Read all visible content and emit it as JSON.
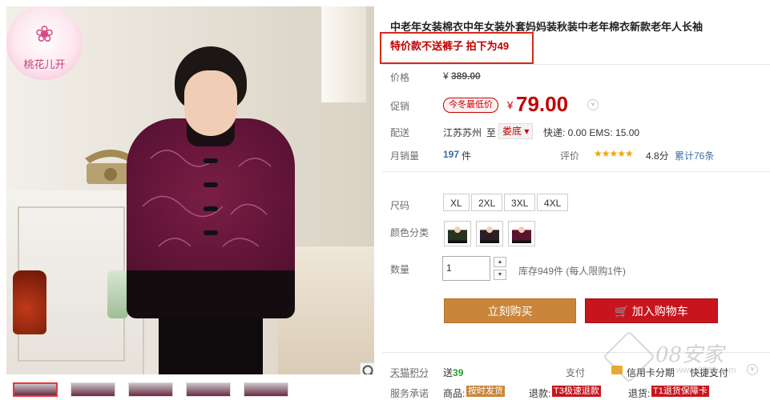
{
  "gallery": {
    "logo_mark": "❀",
    "logo_text": "桃花儿开",
    "zoom_icon": "magnifier-icon"
  },
  "product": {
    "title": "中老年女装棉衣中年女装外套妈妈装秋装中老年棉衣新款老年人长袖",
    "promo_note": "特价款不送裤子 拍下为49"
  },
  "price": {
    "orig_label": "价格",
    "orig_currency": "¥",
    "orig_value": "389.00",
    "promo_label": "促销",
    "badge": "今冬最低价",
    "currency": "¥",
    "value": "79.00",
    "dropdown_icon": "˅"
  },
  "shipping": {
    "label": "配送",
    "from": "江苏苏州",
    "to_label": "至",
    "dest": "娄底 ▾",
    "cost": "快递: 0.00 EMS: 15.00"
  },
  "sales": {
    "label": "月销量",
    "count": "197",
    "unit": "件",
    "rating_label": "评价",
    "stars": "★★★★★",
    "score": "4.8分",
    "total": "累计76条"
  },
  "options": {
    "size_label": "尺码",
    "sizes": [
      "XL",
      "2XL",
      "3XL",
      "4XL"
    ],
    "color_label": "颜色分类",
    "colors": [
      "#26331f",
      "#2a1f26",
      "#5a1430"
    ],
    "qty_label": "数量",
    "qty_value": "1",
    "stock": "库存949件  (每人限购1件)",
    "up_icon": "▲",
    "down_icon": "▼"
  },
  "actions": {
    "buy_now": "立刻购买",
    "cart_icon": "🛒",
    "add_cart": "加入购物车"
  },
  "extras": {
    "points_label": "天猫积分",
    "points_prefix": "送",
    "points_value": "39",
    "pay_label": "支付",
    "card_label": "信用卡分期",
    "fast_pay": "快捷支付",
    "pay_dd": "˅",
    "service_label": "服务承诺",
    "svc_goods": "商品:",
    "svc_goods_tag": "按时发货",
    "svc_refund": "退款:",
    "svc_refund_tag": "T3极速退款",
    "svc_return": "退货:",
    "svc_return_tag": "T1退货保障卡"
  },
  "watermark": {
    "text": "08安家",
    "sub": "www.0888.com"
  }
}
